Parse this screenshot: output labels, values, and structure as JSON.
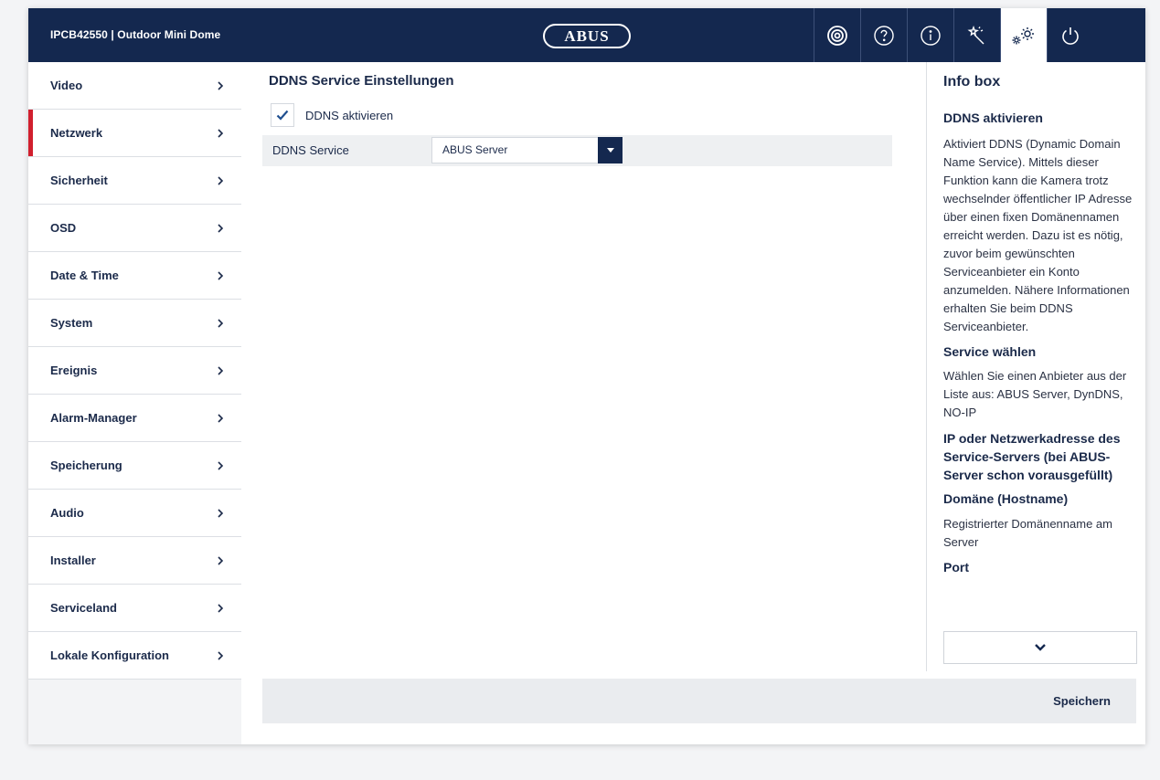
{
  "header": {
    "device_title": "IPCB42550  |  Outdoor Mini Dome",
    "logo_text": "ABUS",
    "icons": [
      "live-view-icon",
      "help-icon",
      "info-icon",
      "wizard-icon",
      "settings-icon",
      "power-icon"
    ],
    "active_icon": "settings-icon"
  },
  "sidebar": {
    "items": [
      {
        "label": "Video",
        "active": false
      },
      {
        "label": "Netzwerk",
        "active": true
      },
      {
        "label": "Sicherheit",
        "active": false
      },
      {
        "label": "OSD",
        "active": false
      },
      {
        "label": "Date & Time",
        "active": false
      },
      {
        "label": "System",
        "active": false
      },
      {
        "label": "Ereignis",
        "active": false
      },
      {
        "label": "Alarm-Manager",
        "active": false
      },
      {
        "label": "Speicherung",
        "active": false
      },
      {
        "label": "Audio",
        "active": false
      },
      {
        "label": "Installer",
        "active": false
      },
      {
        "label": "Serviceland",
        "active": false
      },
      {
        "label": "Lokale Konfiguration",
        "active": false
      }
    ]
  },
  "main": {
    "title": "DDNS Service Einstellungen",
    "enable_label": "DDNS aktivieren",
    "enable_checked": true,
    "service_label": "DDNS Service",
    "service_value": "ABUS Server"
  },
  "infobox": {
    "title": "Info box",
    "h1": "DDNS aktivieren",
    "p1": "Aktiviert DDNS (Dynamic Domain Name Service). Mittels dieser Funktion kann die Kamera trotz wechselnder öffentlicher IP Adresse über einen fixen Domänennamen erreicht werden. Dazu ist es nötig, zuvor beim gewünschten Serviceanbieter ein Konto anzumelden. Nähere Informationen erhalten Sie beim DDNS Serviceanbieter.",
    "h2": "Service wählen",
    "p2": "Wählen Sie einen Anbieter aus der Liste aus: ABUS Server, DynDNS, NO-IP",
    "h3": "IP oder Netzwerkadresse des Service-Servers (bei ABUS-Server schon vorausgefüllt)",
    "h4": "Domäne (Hostname)",
    "p4": "Registrierter Domänenname am Server",
    "h5": "Port"
  },
  "footer": {
    "save_label": "Speichern"
  },
  "colors": {
    "navy": "#14284f",
    "active_marker": "#d11f2e",
    "check": "#1f4f8f"
  }
}
